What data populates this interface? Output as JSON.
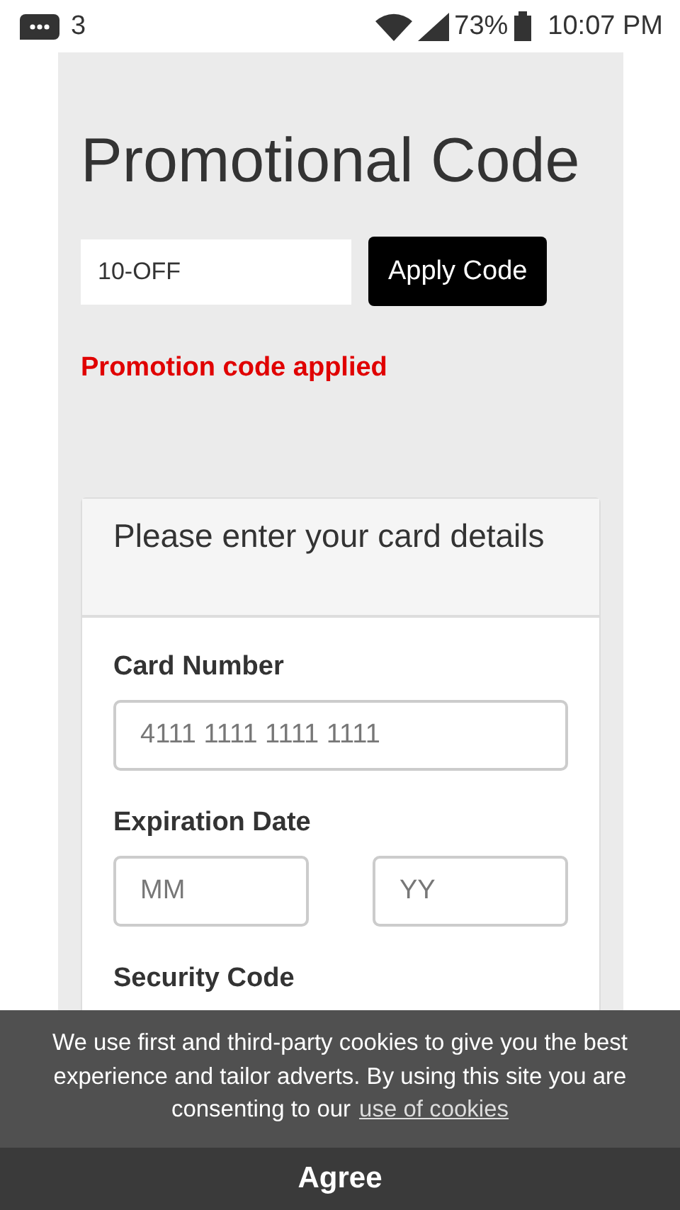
{
  "status_bar": {
    "notification_count": "3",
    "battery": "73%",
    "time": "10:07 PM"
  },
  "promo": {
    "title": "Promotional Code",
    "code_value": "10-OFF",
    "apply_button": "Apply Code",
    "message": "Promotion code applied"
  },
  "card": {
    "header": "Please enter your card details",
    "card_number_label": "Card Number",
    "card_number_placeholder": "4111 1111 1111 1111",
    "expiration_label": "Expiration Date",
    "month_placeholder": "MM",
    "year_placeholder": "YY",
    "security_label": "Security Code"
  },
  "cookie_banner": {
    "text": "We use first and third-party cookies to give you the best experience and tailor adverts. By using this site you are consenting to our",
    "link": "use of cookies",
    "agree_button": "Agree"
  }
}
